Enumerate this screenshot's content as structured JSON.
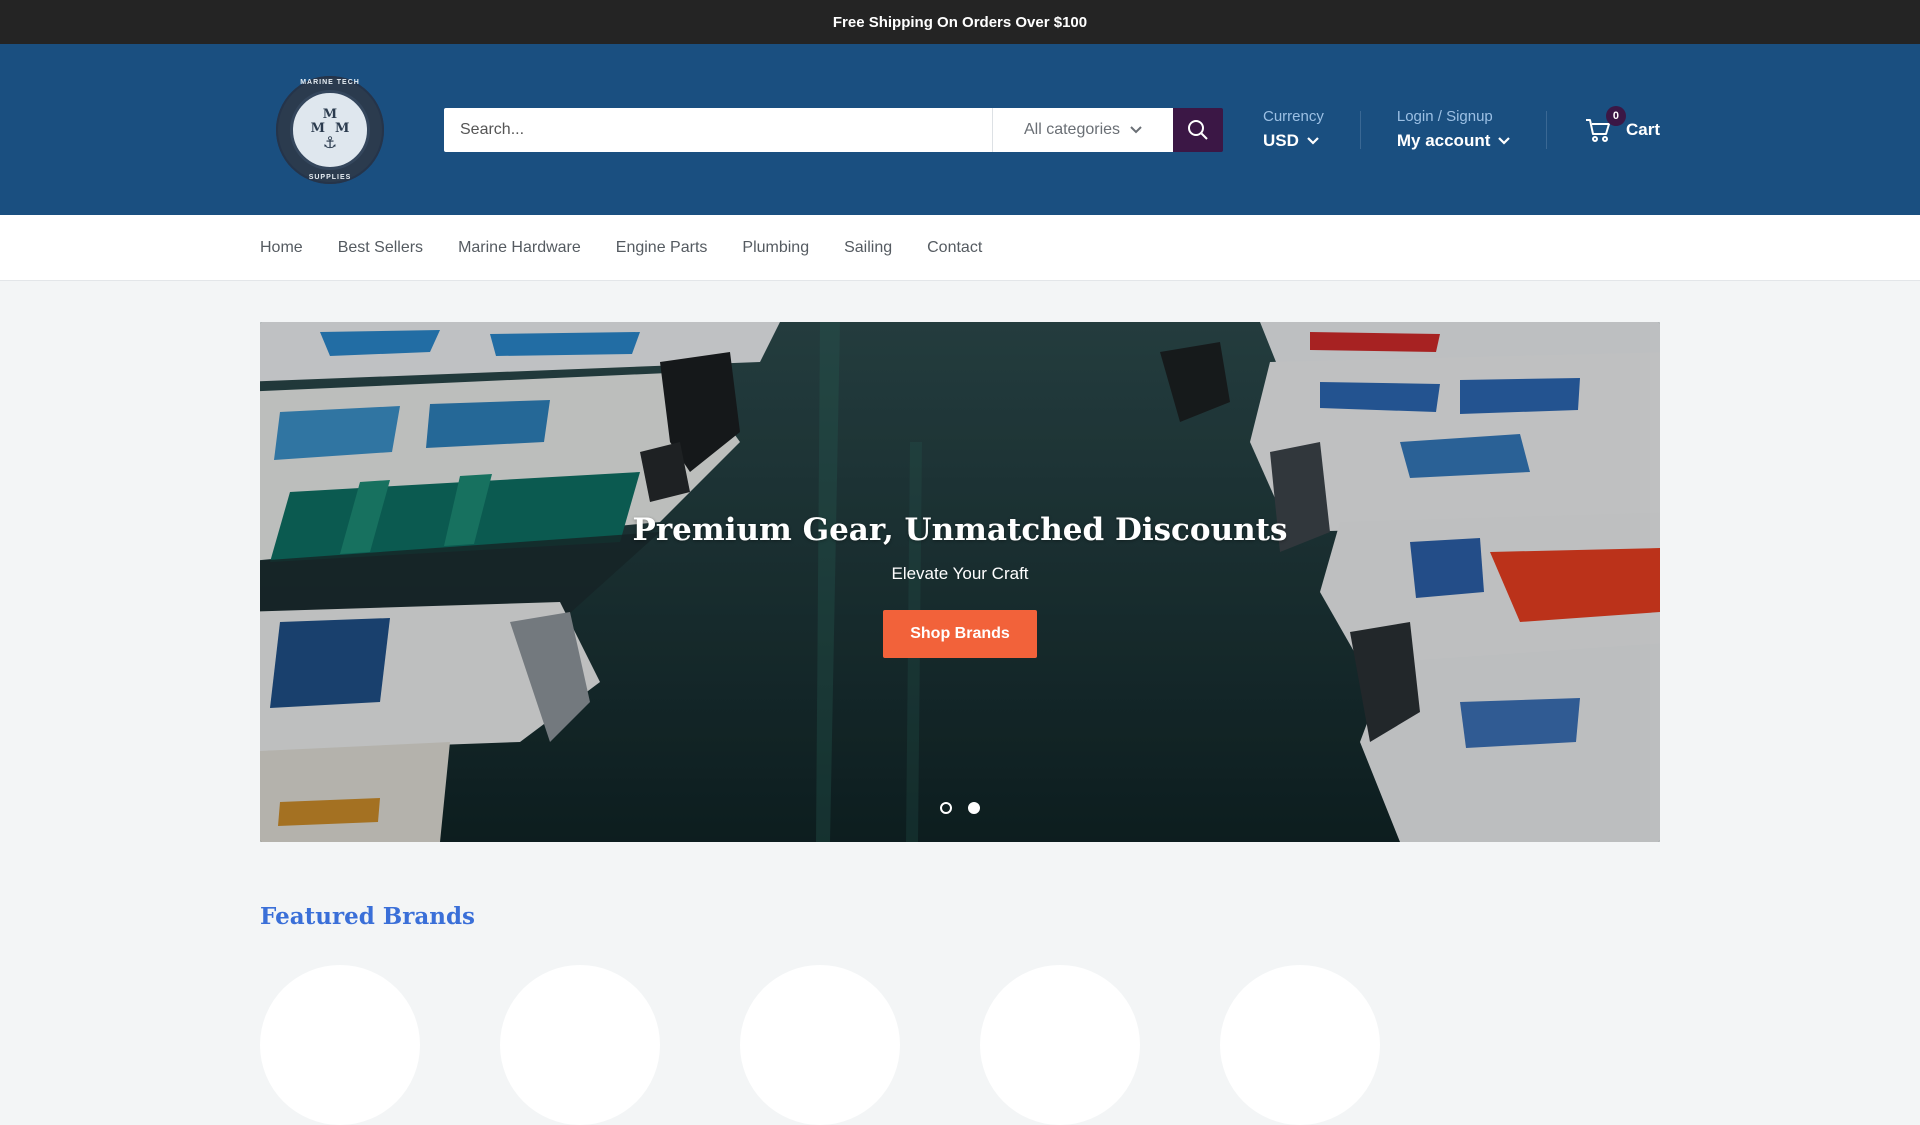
{
  "announcement": "Free Shipping On Orders Over $100",
  "logo": {
    "top_text": "MARINE TECH",
    "bottom_text": "SUPPLIES",
    "mark_top": "M",
    "mark_left": "M",
    "mark_right": "M"
  },
  "search": {
    "placeholder": "Search...",
    "category": "All categories",
    "icon": "search-icon"
  },
  "currency": {
    "label": "Currency",
    "value": "USD"
  },
  "account": {
    "label": "Login / Signup",
    "value": "My account"
  },
  "cart": {
    "label": "Cart",
    "count": "0",
    "icon": "cart-icon"
  },
  "nav": [
    "Home",
    "Best Sellers",
    "Marine Hardware",
    "Engine Parts",
    "Plumbing",
    "Sailing",
    "Contact"
  ],
  "hero": {
    "title": "Premium Gear, Unmatched Discounts",
    "subtitle": "Elevate Your Craft",
    "button": "Shop Brands",
    "slides": 2,
    "active_slide": 2
  },
  "featured": {
    "title": "Featured Brands"
  },
  "colors": {
    "header": "#1a4f80",
    "announce": "#242424",
    "accent": "#3b1745",
    "cta": "#f2623a",
    "featured_title": "#3a6fd8"
  }
}
